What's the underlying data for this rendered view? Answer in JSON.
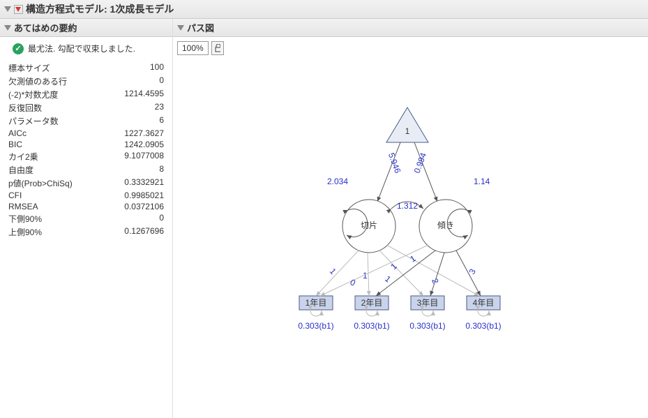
{
  "title": "構造方程式モデル: 1次成長モデル",
  "left": {
    "header": "あてはめの要約",
    "converged": "最尤法. 勾配で収束しました.",
    "stats": [
      {
        "label": "標本サイズ",
        "value": "100"
      },
      {
        "label": "欠測値のある行",
        "value": "0"
      },
      {
        "label": "(-2)*対数尤度",
        "value": "1214.4595"
      },
      {
        "label": "反復回数",
        "value": "23"
      },
      {
        "label": "パラメータ数",
        "value": "6"
      },
      {
        "label": "AICc",
        "value": "1227.3627"
      },
      {
        "label": "BIC",
        "value": "1242.0905"
      },
      {
        "label": "カイ2乗",
        "value": "9.1077008"
      },
      {
        "label": "自由度",
        "value": "8"
      },
      {
        "label": "p値(Prob>ChiSq)",
        "value": "0.3332921"
      },
      {
        "label": "CFI",
        "value": "0.9985021"
      },
      {
        "label": "RMSEA",
        "value": "0.0372106"
      },
      {
        "label": "下側90%",
        "value": "0"
      },
      {
        "label": "上側90%",
        "value": "0.1267696"
      }
    ]
  },
  "right": {
    "header": "パス図",
    "zoom": "100%"
  },
  "diagram": {
    "constant": "1",
    "latent1": "切片",
    "latent2": "傾き",
    "observed": [
      "1年目",
      "2年目",
      "3年目",
      "4年目"
    ],
    "intercept_to_L1": "5.946",
    "intercept_to_L2": "0.994",
    "var_L1": "2.034",
    "var_L2": "1.14",
    "cov_L1_L2": "1.312",
    "load_L1": [
      "1",
      "1",
      "1",
      "1"
    ],
    "load_L2": [
      "0",
      "1",
      "2",
      "3"
    ],
    "err_label": "0.303(b1)"
  }
}
